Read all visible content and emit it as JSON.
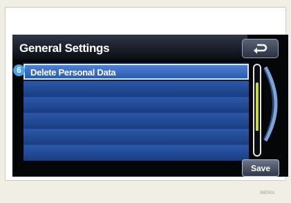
{
  "screen": {
    "title": "General Settings",
    "callout_number": "6",
    "list": {
      "items": [
        {
          "label": "Delete Personal Data",
          "selected": true
        },
        {
          "label": ""
        },
        {
          "label": ""
        },
        {
          "label": ""
        },
        {
          "label": ""
        },
        {
          "label": ""
        }
      ]
    },
    "save_label": "Save",
    "back_icon": "back-arrow-icon",
    "scroll_position": 0.45
  },
  "figure": {
    "ref_code": "I5IES01"
  },
  "colors": {
    "row_blue": "#2c58a8",
    "selected_row": "#4f80d2",
    "callout": "#4aa3e6",
    "scroll_thumb": "#c9d74a"
  }
}
